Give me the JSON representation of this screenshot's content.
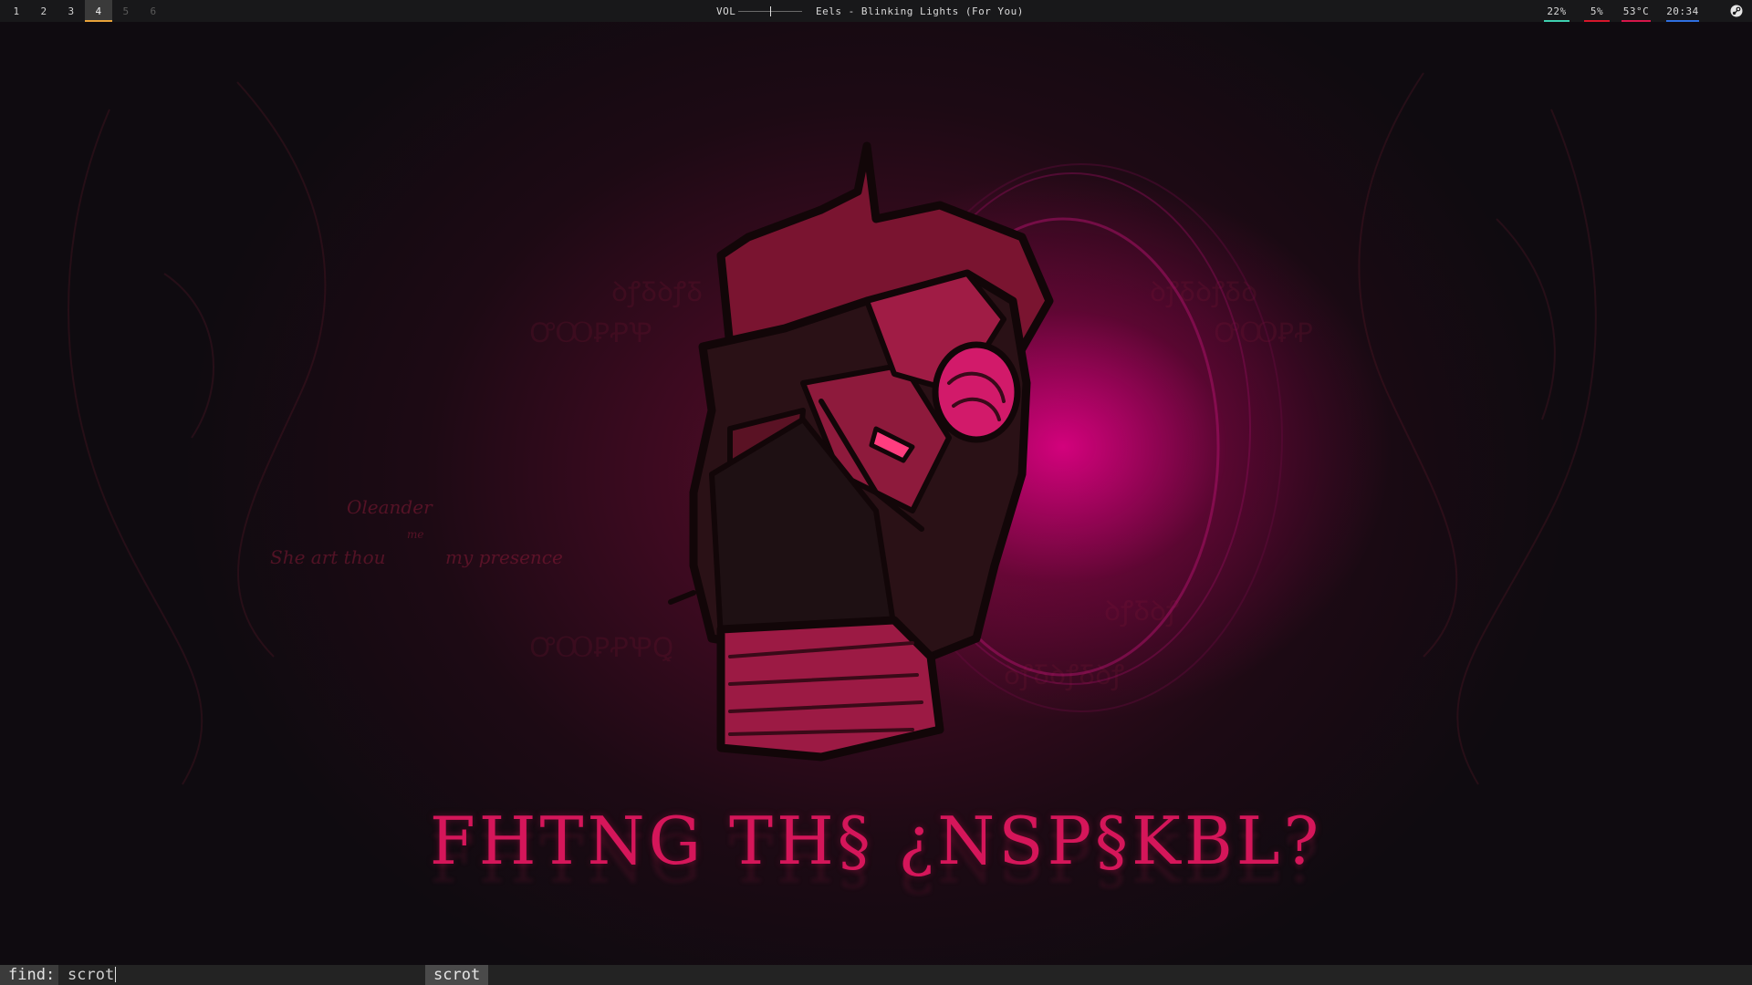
{
  "topbar": {
    "workspaces": [
      {
        "label": "1",
        "state": "occupied"
      },
      {
        "label": "2",
        "state": "occupied"
      },
      {
        "label": "3",
        "state": "occupied"
      },
      {
        "label": "4",
        "state": "active"
      },
      {
        "label": "5",
        "state": "empty"
      },
      {
        "label": "6",
        "state": "empty"
      }
    ],
    "volume": {
      "label": "VOL",
      "level": 0.5
    },
    "now_playing": "Eels - Blinking Lights (For You)",
    "stats": [
      {
        "name": "cpu",
        "value": "22%",
        "color": "#3ecfb0"
      },
      {
        "name": "memory",
        "value": "5%",
        "color": "#d6162b"
      },
      {
        "name": "temperature",
        "value": "53°C",
        "color": "#d6164a"
      },
      {
        "name": "clock",
        "value": "20:34",
        "color": "#2f6fe0"
      }
    ],
    "tray_icon": "steam-icon"
  },
  "wallpaper": {
    "title": "FHTNG TH§ ¿NSP§KBL?",
    "script_lines": [
      "Oleander",
      "me",
      "She art thou",
      "my presence"
    ],
    "accent": "#ec008c"
  },
  "findbar": {
    "label": "find:",
    "input_value": "scrot",
    "result": "scrot"
  }
}
